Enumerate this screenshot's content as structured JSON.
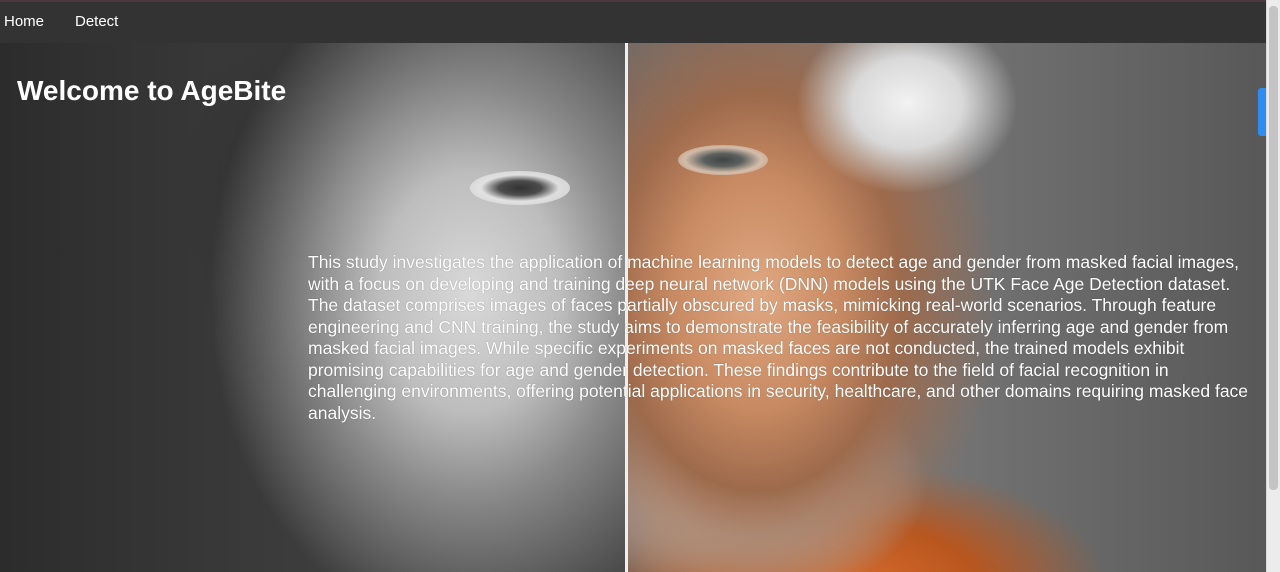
{
  "nav": {
    "home_label": "Home",
    "detect_label": "Detect"
  },
  "hero": {
    "title": "Welcome to AgeBite",
    "description": "This study investigates the application of machine learning models to detect age and gender from masked facial images, with a focus on developing and training deep neural network (DNN) models using the UTK Face Age Detection dataset. The dataset comprises images of faces partially obscured by masks, mimicking real-world scenarios. Through feature engineering and CNN training, the study aims to demonstrate the feasibility of accurately inferring age and gender from masked facial images. While specific experiments on masked faces are not conducted, the trained models exhibit promising capabilities for age and gender detection. These findings contribute to the field of facial recognition in challenging environments, offering potential applications in security, healthcare, and other domains requiring masked face analysis."
  },
  "colors": {
    "navbar_bg": "#333333",
    "text": "#ffffff",
    "scroll_accent": "#2f8cf0"
  }
}
